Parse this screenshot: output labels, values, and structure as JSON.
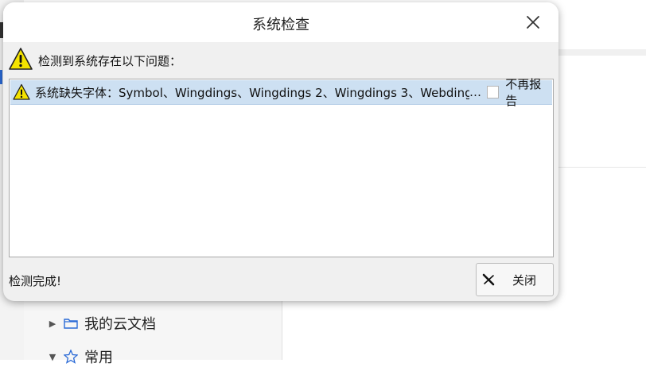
{
  "dialog": {
    "title": "系统检查",
    "close_icon": "close-icon",
    "header": "检测到系统存在以下问题：",
    "issues": [
      {
        "icon": "warning-icon",
        "text": "系统缺失字体：Symbol、Wingdings、Wingdings 2、Wingdings 3、Webdings、",
        "ellipsis": "…",
        "checkbox_label": "不再报告",
        "checked": false
      }
    ],
    "status": "检测完成!",
    "close_button_label": "关闭"
  },
  "background": {
    "sidebar_items": [
      {
        "label": "我的云文档",
        "icon": "folder-icon",
        "expanded": false
      },
      {
        "label": "常用",
        "icon": "star-icon",
        "expanded": true
      }
    ]
  },
  "colors": {
    "selection": "#cde0f2",
    "warning_yellow": "#f4e300",
    "dialog_bg": "#f0f0f0",
    "folder_blue": "#2a6ad6"
  }
}
